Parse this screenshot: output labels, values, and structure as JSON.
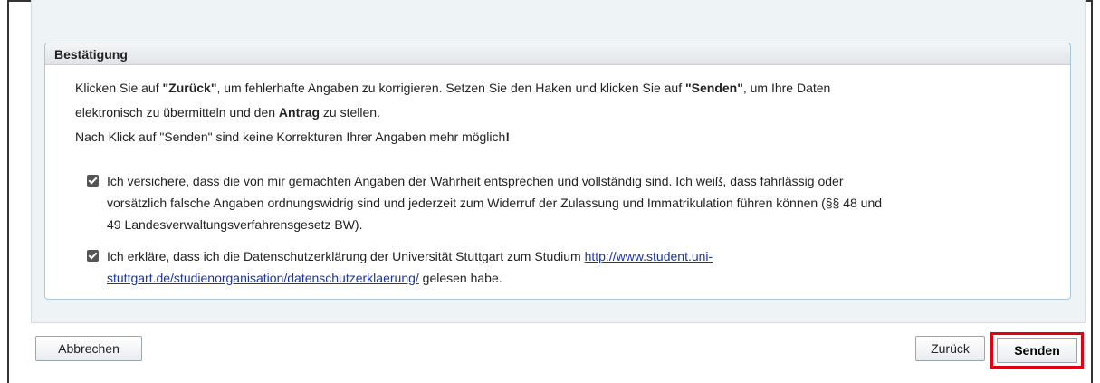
{
  "section": {
    "title": "Bestätigung",
    "intro_line1_a": "Klicken Sie auf ",
    "intro_zurueck": "\"Zurück\"",
    "intro_line1_b": ", um fehlerhafte Angaben zu korrigieren. Setzen Sie den Haken und klicken Sie auf ",
    "intro_senden": "\"Senden\"",
    "intro_line1_c": ", um Ihre Daten",
    "intro_line2_a": "elektronisch zu übermitteln und den ",
    "intro_antrag": "Antrag",
    "intro_line2_b": " zu stellen.",
    "intro_line3_a": "Nach Klick auf \"Senden\" sind keine Korrekturen Ihrer Angaben mehr möglich",
    "intro_line3_b": "!"
  },
  "checkboxes": [
    {
      "checked": true,
      "line1": "Ich versichere, dass die von mir gemachten Angaben der Wahrheit entsprechen und vollständig sind. Ich weiß, dass fahrlässig oder",
      "line2": "vorsätzlich falsche Angaben ordnungswidrig sind und jederzeit zum Widerruf der Zulassung und Immatrikulation führen können (§§ 48 und",
      "line3": "49 Landesverwaltungsverfahrensgesetz BW)."
    },
    {
      "checked": true,
      "text_a": "Ich erkläre, dass ich die Datenschutzerklärung der Universität Stuttgart zum Studium ",
      "link_line1": "http://www.student.uni-",
      "link_line2": "stuttgart.de/studienorganisation/datenschutzerklaerung/",
      "text_b": " gelesen habe."
    }
  ],
  "buttons": {
    "cancel": "Abbrechen",
    "back": "Zurück",
    "send": "Senden"
  },
  "colors": {
    "highlight": "#e0000f",
    "link": "#1a34a6"
  }
}
